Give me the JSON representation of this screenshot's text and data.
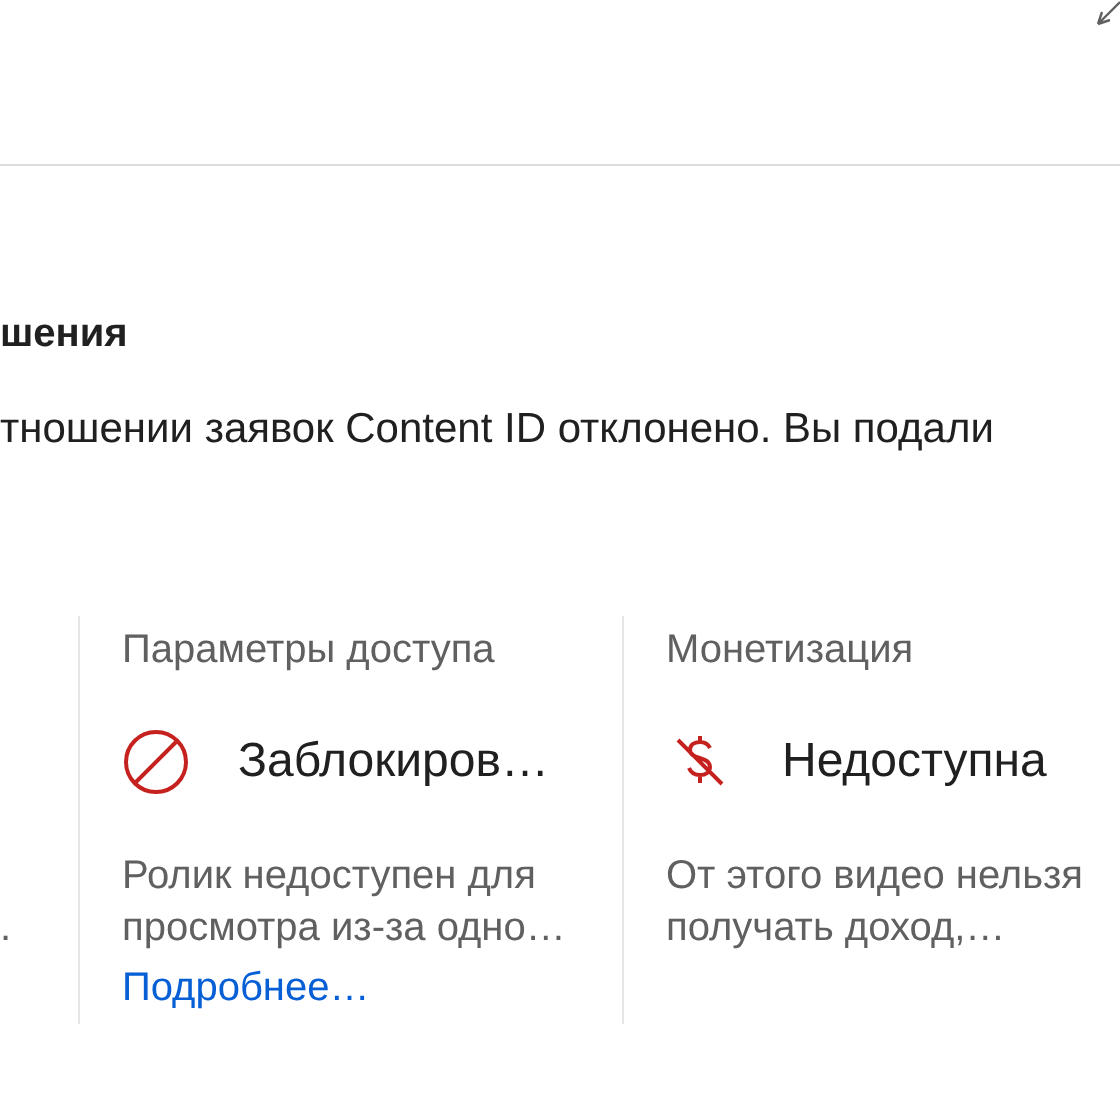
{
  "section": {
    "title": "шения",
    "text": "тношении заявок Content ID отклонено. Вы подали"
  },
  "cards": [
    {
      "kind": "cut",
      "description": "."
    },
    {
      "kind": "blocked",
      "label": "Параметры доступа",
      "value": "Заблокиров…",
      "description": "Ролик недоступен для просмотра из-за одно…",
      "link": "Подробнее…"
    },
    {
      "kind": "no-money",
      "label": "Монетизация",
      "value": "Недоступна",
      "description": "От этого видео нельзя получать доход,…"
    }
  ]
}
